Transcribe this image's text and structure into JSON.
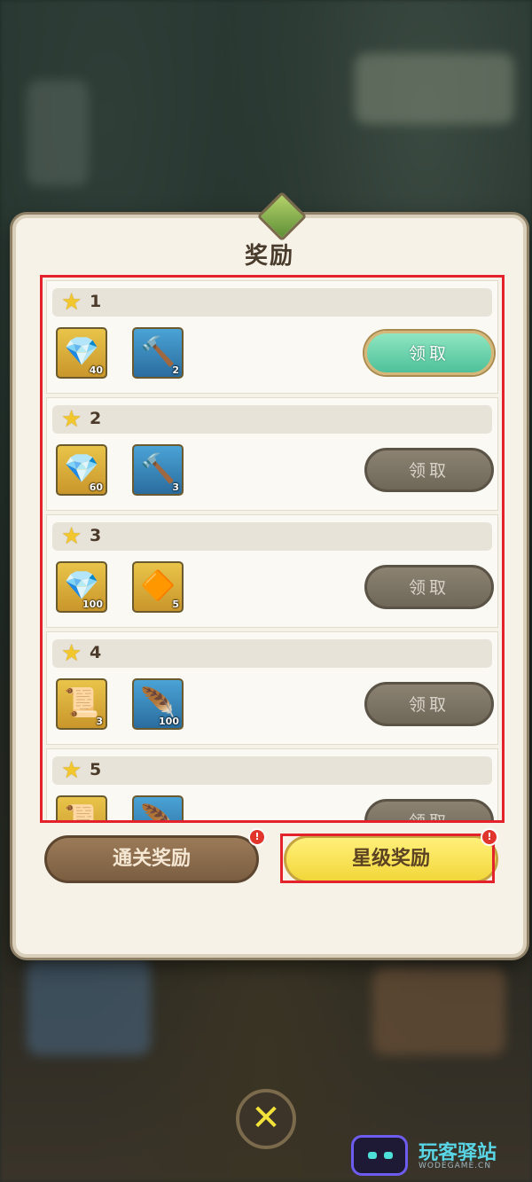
{
  "dialog": {
    "title": "奖励",
    "rewards": [
      {
        "star_label": "1",
        "items": [
          {
            "icon": "crystal-ore-icon",
            "glyph": "💎",
            "frame": "gold",
            "qty": "40"
          },
          {
            "icon": "hammer-icon",
            "glyph": "🔨",
            "frame": "blue",
            "qty": "2"
          }
        ],
        "claim_label": "领取",
        "claim_state": "active"
      },
      {
        "star_label": "2",
        "items": [
          {
            "icon": "crystal-ore-icon",
            "glyph": "💎",
            "frame": "gold",
            "qty": "60"
          },
          {
            "icon": "hammer-icon",
            "glyph": "🔨",
            "frame": "blue",
            "qty": "3"
          }
        ],
        "claim_label": "领取",
        "claim_state": "disabled"
      },
      {
        "star_label": "3",
        "items": [
          {
            "icon": "crystal-ore-icon",
            "glyph": "💎",
            "frame": "gold",
            "qty": "100"
          },
          {
            "icon": "amber-gem-icon",
            "glyph": "🔶",
            "frame": "gold",
            "qty": "5"
          }
        ],
        "claim_label": "领取",
        "claim_state": "disabled"
      },
      {
        "star_label": "4",
        "items": [
          {
            "icon": "scroll-icon",
            "glyph": "📜",
            "frame": "gold",
            "qty": "3"
          },
          {
            "icon": "feather-icon",
            "glyph": "🪶",
            "frame": "blue",
            "qty": "100"
          }
        ],
        "claim_label": "领取",
        "claim_state": "disabled"
      },
      {
        "star_label": "5",
        "items": [
          {
            "icon": "scroll-icon",
            "glyph": "📜",
            "frame": "gold",
            "qty": ""
          },
          {
            "icon": "feather-icon",
            "glyph": "🪶",
            "frame": "blue",
            "qty": ""
          }
        ],
        "claim_label": "领取",
        "claim_state": "disabled"
      }
    ],
    "tabs": {
      "clear_rewards": "通关奖励",
      "star_rewards": "星级奖励"
    }
  },
  "watermark": {
    "text": "玩客驿站",
    "sub": "WODEGAME.CN"
  },
  "colors": {
    "highlight": "#e4222b",
    "claim_active": "#4ec19a",
    "tab_active": "#f2d73a"
  }
}
